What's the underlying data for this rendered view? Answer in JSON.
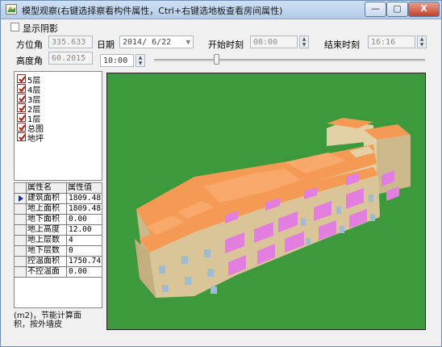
{
  "window": {
    "title": "模型观察(右键选择察看构件属性，Ctrl+右键选地板查看房间属性)",
    "minimize_label": "—",
    "maximize_label": "▢",
    "close_label": "X"
  },
  "toolbar": {
    "show_shadow_label": "显示阴影",
    "show_shadow_checked": false,
    "azimuth_label": "方位角",
    "azimuth_value": "335.633",
    "altitude_label": "高度角",
    "altitude_value": "60.2015",
    "date_label": "日期",
    "date_value": "2014/ 6/22",
    "start_time_label": "开始时刻",
    "start_time_value": "08:00",
    "end_time_label": "结束时刻",
    "end_time_value": "16:16",
    "current_time_value": "10:00",
    "time_slider_fraction": 0.23
  },
  "layers": {
    "items": [
      {
        "label": "5层",
        "checked": true
      },
      {
        "label": "4层",
        "checked": true
      },
      {
        "label": "3层",
        "checked": true
      },
      {
        "label": "2层",
        "checked": true
      },
      {
        "label": "1层",
        "checked": true
      },
      {
        "label": "总图",
        "checked": true
      },
      {
        "label": "地坪",
        "checked": true
      }
    ]
  },
  "properties": {
    "header_name": "属性名",
    "header_value": "属性值",
    "rows": [
      {
        "name": "建筑面积",
        "value": "1809.48",
        "selected": true
      },
      {
        "name": "地上面积",
        "value": "1809.48",
        "selected": false
      },
      {
        "name": "地下面积",
        "value": "0.00",
        "selected": false
      },
      {
        "name": "地上高度",
        "value": "12.00",
        "selected": false
      },
      {
        "name": "地上层数",
        "value": "4",
        "selected": false
      },
      {
        "name": "地下层数",
        "value": "0",
        "selected": false
      },
      {
        "name": "控温面积",
        "value": "1750.74",
        "selected": false
      },
      {
        "name": "不控温面",
        "value": "0.00",
        "selected": false
      }
    ],
    "description_line1": "(m2)，节能计算面",
    "description_line2": "积，按外墙皮"
  },
  "colors": {
    "viewport_background": "#3c9a3c",
    "roof": "#f59a55",
    "wall": "#e3d1a5",
    "wall_shade": "#cbb88b",
    "window_pink": "#e27ee0",
    "window_blue": "#9fbcd0",
    "checkmark": "#c21010"
  }
}
